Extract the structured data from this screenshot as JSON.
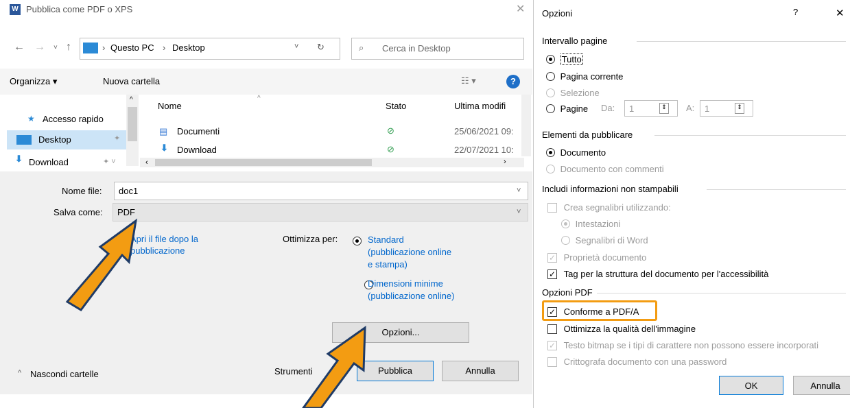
{
  "left": {
    "title": "Pubblica come PDF o XPS",
    "breadcrumb": [
      "Questo PC",
      "Desktop"
    ],
    "search_placeholder": "Cerca in Desktop",
    "toolbar": {
      "organize": "Organizza ▾",
      "new_folder": "Nuova cartella"
    },
    "sidebar": [
      {
        "label": "Accesso rapido",
        "icon": "star-icon"
      },
      {
        "label": "Desktop",
        "icon": "desktop-icon"
      },
      {
        "label": "Download",
        "icon": "download-icon"
      }
    ],
    "columns": [
      "Nome",
      "Stato",
      "Ultima modifi"
    ],
    "rows": [
      {
        "name": "Documenti",
        "date": "25/06/2021 09:"
      },
      {
        "name": "Download",
        "date": "22/07/2021 10:"
      }
    ],
    "file_name_label": "Nome file:",
    "file_name_value": "doc1",
    "save_as_label": "Salva come:",
    "save_as_value": "PDF",
    "open_after_line1": "Apri il file dopo la",
    "open_after_line2": "pubblicazione",
    "optimize_label": "Ottimizza per:",
    "opt_standard_lines": [
      "Standard",
      "(pubblicazione online",
      "e stampa)"
    ],
    "opt_min_lines": [
      "Dimensioni minime",
      "(pubblicazione online)"
    ],
    "options_button": "Opzioni...",
    "tools_label": "Strumenti",
    "publish_button": "Pubblica",
    "cancel_button": "Annulla",
    "hide_folders": "Nascondi cartelle"
  },
  "right": {
    "title": "Opzioni",
    "help": "?",
    "close": "✕",
    "page_range_title": "Intervallo pagine",
    "page_range": [
      "Tutto",
      "Pagina corrente",
      "Selezione",
      "Pagine"
    ],
    "from_label": "Da:",
    "from_value": "1",
    "to_label": "A:",
    "to_value": "1",
    "publish_what_title": "Elementi da pubblicare",
    "publish_what": [
      "Documento",
      "Documento con commenti"
    ],
    "nonprint_title": "Includi informazioni non stampabili",
    "bookmarks": "Crea segnalibri utilizzando:",
    "bookmarks_options": [
      "Intestazioni",
      "Segnalibri di Word"
    ],
    "doc_props": "Proprietà documento",
    "tags": "Tag per la struttura del documento per l'accessibilità",
    "pdf_options_title": "Opzioni PDF",
    "pdfa": "Conforme a PDF/A",
    "optimize_image": "Ottimizza la qualità dell'immagine",
    "bitmap_text": "Testo bitmap se i tipi di carattere non possono essere incorporati",
    "encrypt": "Crittografa documento con una password",
    "ok": "OK",
    "cancel": "Annulla"
  },
  "colors": {
    "accent": "#0078d7",
    "highlight": "#f39c12",
    "link": "#0066cc"
  }
}
